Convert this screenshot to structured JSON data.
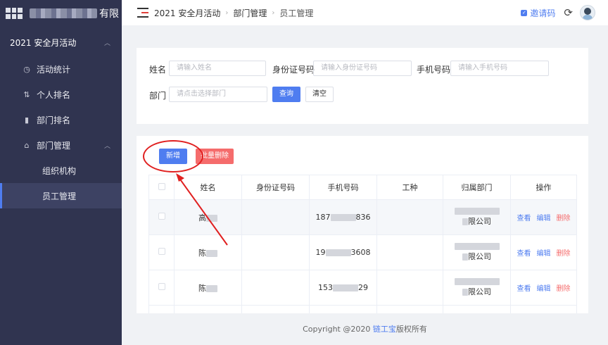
{
  "sidebar": {
    "logo_text": "有限",
    "group": "2021 安全月活动",
    "items": [
      {
        "label": "活动统计",
        "icon": "clock-icon"
      },
      {
        "label": "个人排名",
        "icon": "sort-icon"
      },
      {
        "label": "部门排名",
        "icon": "bar-chart-icon"
      },
      {
        "label": "部门管理",
        "icon": "home-icon"
      }
    ],
    "sub_items": [
      "组织机构",
      "员工管理"
    ]
  },
  "header": {
    "breadcrumb": [
      "2021 安全月活动",
      "部门管理",
      "员工管理"
    ],
    "invite": "邀请码"
  },
  "filter": {
    "name_label": "姓名",
    "name_placeholder": "请输入姓名",
    "id_label": "身份证号码",
    "id_placeholder": "请输入身份证号码",
    "phone_label": "手机号码",
    "phone_placeholder": "请输入手机号码",
    "dept_label": "部门",
    "dept_placeholder": "请点击选择部门",
    "search": "查询",
    "clear": "清空"
  },
  "toolbar": {
    "add": "新增",
    "batch_delete": "批量删除"
  },
  "table": {
    "columns": [
      "姓名",
      "身份证号码",
      "手机号码",
      "工种",
      "归属部门",
      "操作"
    ],
    "rows": [
      {
        "name": "高",
        "phone_a": "187",
        "phone_b": "836",
        "dept": "限公司"
      },
      {
        "name": "陈",
        "phone_a": "19",
        "phone_b": "3608",
        "dept": "限公司"
      },
      {
        "name": "陈",
        "phone_a": "153",
        "phone_b": "29",
        "dept": "限公司"
      }
    ],
    "ops": {
      "view": "查看",
      "edit": "编辑",
      "delete": "删除"
    }
  },
  "footer": {
    "prefix": "Copyright @2020 ",
    "brand": "链工宝",
    "suffix": "版权所有"
  },
  "colors": {
    "primary": "#4f7df0",
    "danger": "#f56c6c",
    "sidebar": "#303450",
    "annotation": "#e02020"
  }
}
